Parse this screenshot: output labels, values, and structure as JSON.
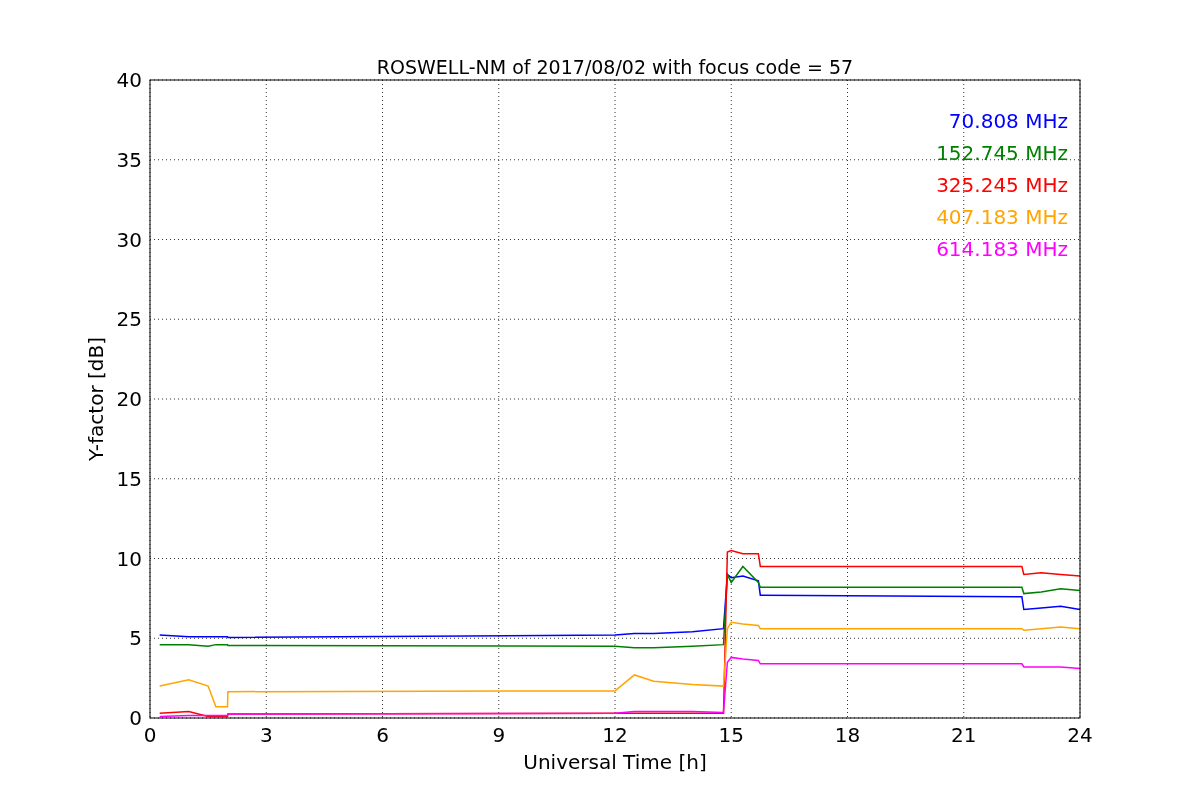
{
  "chart_data": {
    "type": "line",
    "title": "ROSWELL-NM of 2017/08/02 with focus code = 57",
    "xlabel": "Universal Time [h]",
    "ylabel": "Y-factor [dB]",
    "x": [
      0.25,
      1,
      1.5,
      1.7,
      2,
      2.01,
      12,
      12.5,
      13,
      14,
      14.8,
      14.9,
      15,
      15.3,
      15.7,
      15.75,
      22.5,
      22.55,
      23,
      23.5,
      24
    ],
    "series": [
      {
        "name": "70.808 MHz",
        "color": "#0000ff",
        "values": [
          5.2,
          5.1,
          5.1,
          5.1,
          5.1,
          5.05,
          5.2,
          5.3,
          5.3,
          5.4,
          5.6,
          9.0,
          8.8,
          8.9,
          8.6,
          7.7,
          7.6,
          6.8,
          6.9,
          7.0,
          6.8
        ]
      },
      {
        "name": "152.745 MHz",
        "color": "#008000",
        "values": [
          4.6,
          4.6,
          4.5,
          4.6,
          4.6,
          4.55,
          4.5,
          4.4,
          4.4,
          4.5,
          4.6,
          9.0,
          8.5,
          9.5,
          8.5,
          8.2,
          8.2,
          7.8,
          7.9,
          8.1,
          8.0
        ]
      },
      {
        "name": "325.245 MHz",
        "color": "#ff0000",
        "values": [
          0.3,
          0.4,
          0.1,
          0.1,
          0.1,
          0.25,
          0.3,
          0.3,
          0.3,
          0.3,
          0.3,
          10.4,
          10.5,
          10.3,
          10.3,
          9.5,
          9.5,
          9.0,
          9.1,
          9.0,
          8.9
        ]
      },
      {
        "name": "407.183 MHz",
        "color": "#ffa500",
        "values": [
          2.0,
          2.4,
          2.0,
          0.7,
          0.7,
          1.65,
          1.7,
          2.7,
          2.3,
          2.1,
          2.0,
          5.6,
          6.0,
          5.9,
          5.8,
          5.6,
          5.6,
          5.5,
          5.6,
          5.7,
          5.6
        ]
      },
      {
        "name": "614.183 MHz",
        "color": "#ff00ff",
        "values": [
          0.1,
          0.15,
          0.15,
          0.15,
          0.15,
          0.25,
          0.3,
          0.4,
          0.4,
          0.4,
          0.35,
          3.5,
          3.8,
          3.7,
          3.6,
          3.4,
          3.4,
          3.2,
          3.2,
          3.2,
          3.1
        ]
      }
    ],
    "grid": true,
    "xlim": [
      0,
      24
    ],
    "ylim": [
      0,
      40
    ],
    "xticks": [
      0,
      3,
      6,
      9,
      12,
      15,
      18,
      21,
      24
    ],
    "yticks": [
      0,
      5,
      10,
      15,
      20,
      25,
      30,
      35,
      40
    ]
  }
}
